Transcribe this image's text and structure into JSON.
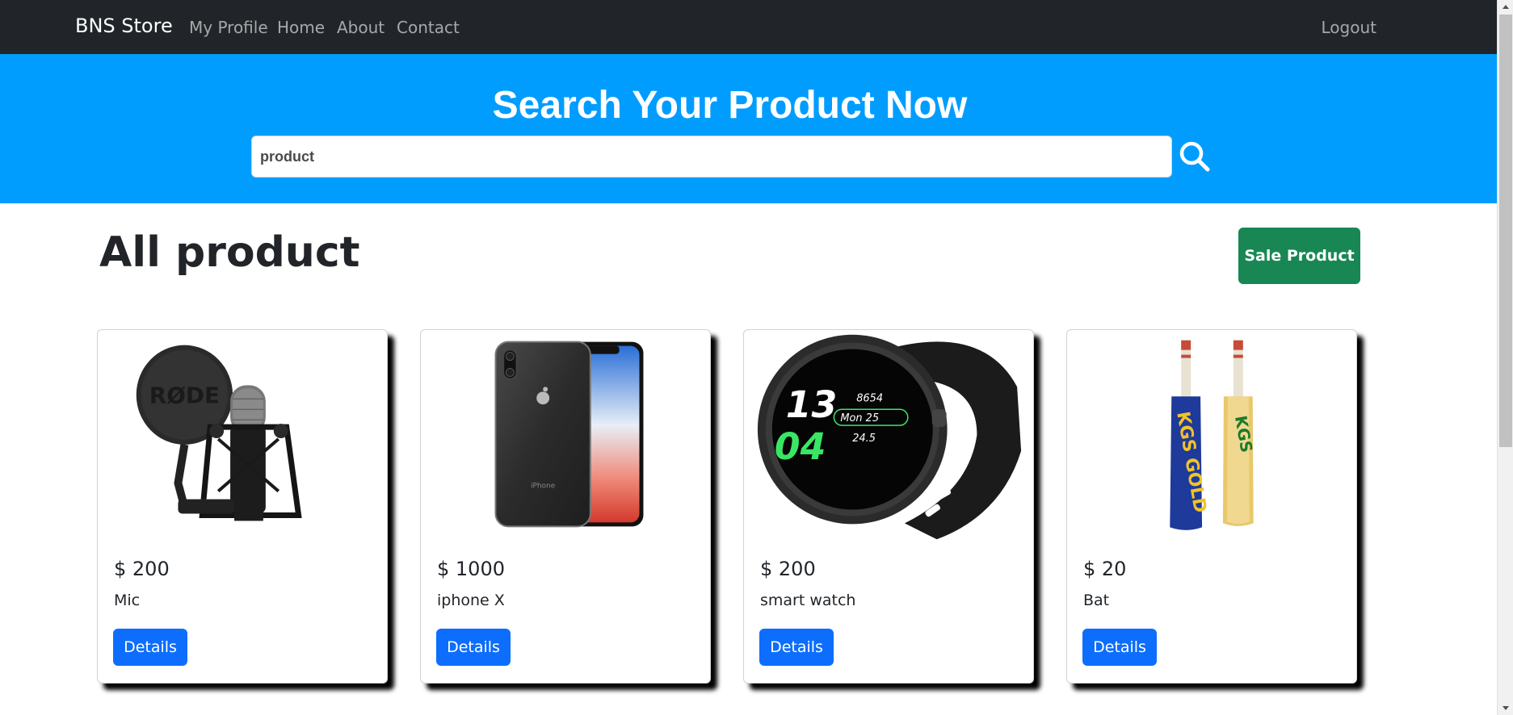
{
  "navbar": {
    "brand": "BNS Store",
    "links": [
      "My Profile",
      "Home",
      "About",
      "Contact"
    ],
    "logout": "Logout"
  },
  "hero": {
    "title": "Search Your Product Now",
    "search_value": "product",
    "search_icon": "search-icon"
  },
  "main": {
    "title": "All product",
    "sale_button": "Sale Product"
  },
  "products": [
    {
      "price": "$ 200",
      "name": "Mic",
      "details": "Details",
      "image": "microphone-image"
    },
    {
      "price": "$ 1000",
      "name": "iphone X",
      "details": "Details",
      "image": "iphone-image"
    },
    {
      "price": "$ 200",
      "name": "smart watch",
      "details": "Details",
      "image": "smartwatch-image"
    },
    {
      "price": "$ 20",
      "name": "Bat",
      "details": "Details",
      "image": "cricket-bat-image"
    }
  ],
  "image_text": {
    "mic_brand": "RØDE",
    "watch_hour": "13",
    "watch_minute": "04",
    "watch_steps": "8654",
    "watch_date": "Mon 25",
    "watch_temp": "24.5",
    "phone_label": "iPhone",
    "bat1_label": "KGS GOLD",
    "bat2_label": "KGS"
  },
  "colors": {
    "navbar_bg": "#212529",
    "hero_bg": "#009dff",
    "sale_button": "#198754",
    "details_button": "#0d6efd"
  }
}
